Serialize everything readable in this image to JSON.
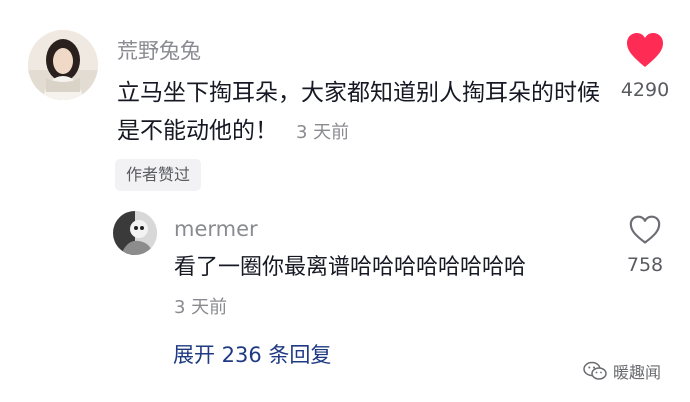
{
  "main_comment": {
    "username": "荒野兔兔",
    "text": "立马坐下掏耳朵，大家都知道别人掏耳朵的时候是不能动他的！",
    "time": "3 天前",
    "author_badge": "作者赞过",
    "likes": "4290",
    "like_icon": "heart-filled-icon",
    "like_color": "#fe2c55"
  },
  "reply": {
    "username": "mermer",
    "text": "看了一圈你最离谱哈哈哈哈哈哈哈哈",
    "time": "3 天前",
    "likes": "758",
    "like_icon": "heart-outline-icon"
  },
  "expand_replies": "展开 236 条回复",
  "watermark": {
    "text": "暖趣闻",
    "icon": "wechat-logo-icon"
  },
  "colors": {
    "link": "#1e3a82",
    "secondary_text": "#8a8b91",
    "primary_text": "#161823"
  }
}
